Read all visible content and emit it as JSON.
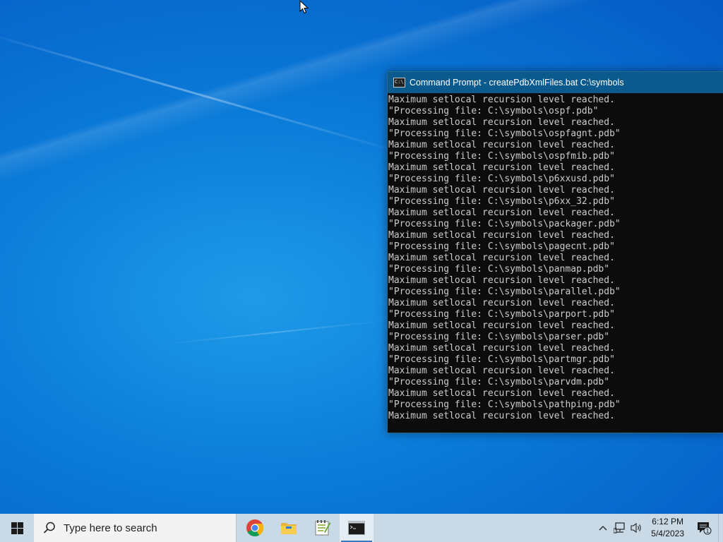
{
  "window": {
    "title": "Command Prompt - createPdbXmlFiles.bat  C:\\symbols",
    "lines": [
      "Maximum setlocal recursion level reached.",
      "\"Processing file: C:\\symbols\\ospf.pdb\"",
      "Maximum setlocal recursion level reached.",
      "\"Processing file: C:\\symbols\\ospfagnt.pdb\"",
      "Maximum setlocal recursion level reached.",
      "\"Processing file: C:\\symbols\\ospfmib.pdb\"",
      "Maximum setlocal recursion level reached.",
      "\"Processing file: C:\\symbols\\p6xxusd.pdb\"",
      "Maximum setlocal recursion level reached.",
      "\"Processing file: C:\\symbols\\p6xx_32.pdb\"",
      "Maximum setlocal recursion level reached.",
      "\"Processing file: C:\\symbols\\packager.pdb\"",
      "Maximum setlocal recursion level reached.",
      "\"Processing file: C:\\symbols\\pagecnt.pdb\"",
      "Maximum setlocal recursion level reached.",
      "\"Processing file: C:\\symbols\\panmap.pdb\"",
      "Maximum setlocal recursion level reached.",
      "\"Processing file: C:\\symbols\\parallel.pdb\"",
      "Maximum setlocal recursion level reached.",
      "\"Processing file: C:\\symbols\\parport.pdb\"",
      "Maximum setlocal recursion level reached.",
      "\"Processing file: C:\\symbols\\parser.pdb\"",
      "Maximum setlocal recursion level reached.",
      "\"Processing file: C:\\symbols\\partmgr.pdb\"",
      "Maximum setlocal recursion level reached.",
      "\"Processing file: C:\\symbols\\parvdm.pdb\"",
      "Maximum setlocal recursion level reached.",
      "\"Processing file: C:\\symbols\\pathping.pdb\"",
      "Maximum setlocal recursion level reached."
    ]
  },
  "taskbar": {
    "search_placeholder": "Type here to search",
    "apps": [
      {
        "name": "chrome-icon"
      },
      {
        "name": "file-explorer-icon"
      },
      {
        "name": "notepad-plus-icon"
      },
      {
        "name": "command-prompt-icon",
        "active": true
      }
    ],
    "clock_time": "6:12 PM",
    "clock_date": "5/4/2023",
    "notification_count": "1"
  },
  "colors": {
    "titlebar": "#0b5a8e",
    "console_bg": "#0c0c0c",
    "console_text": "#cccccc",
    "taskbar": "#c9d9e6"
  }
}
